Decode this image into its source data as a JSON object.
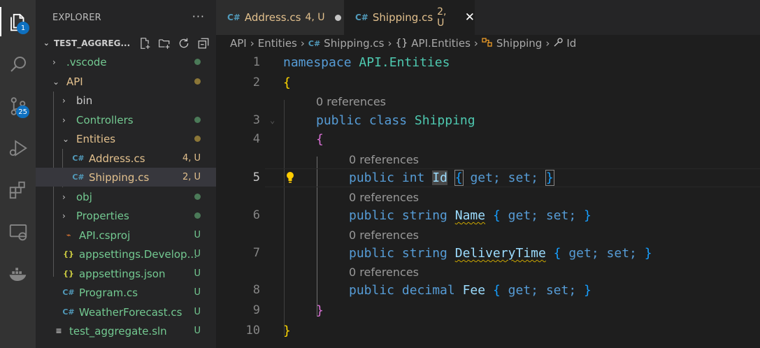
{
  "colors": {
    "accent": "#0e70c0",
    "modified": "#e2c08d",
    "untracked": "#73c991",
    "folder_dot_modified": "#8b7637",
    "folder_dot_green": "#4b7a58",
    "csharp_icon": "#519aba",
    "json_icon": "#cbcb41",
    "xml_icon": "#e37933",
    "sln_icon": "#c5c5c5"
  },
  "activity_bar": {
    "explorer_badge": "1",
    "scm_badge": "25",
    "icons": [
      "files-icon",
      "search-icon",
      "source-control-icon",
      "run-debug-icon",
      "extensions-icon",
      "remote-explorer-icon",
      "docker-icon"
    ]
  },
  "sidebar": {
    "title": "EXPLORER",
    "more_label": "···",
    "folder": "TEST_AGGREG...",
    "items": [
      {
        "label": ".vscode",
        "chevron": "›",
        "status": "",
        "dot": "green"
      },
      {
        "label": "API",
        "chevron": "⌄",
        "status": "",
        "dot": "modified"
      },
      {
        "label": "bin",
        "chevron": "›",
        "status": "",
        "dot": ""
      },
      {
        "label": "Controllers",
        "chevron": "›",
        "status": "",
        "dot": "green"
      },
      {
        "label": "Entities",
        "chevron": "⌄",
        "status": "",
        "dot": "modified"
      },
      {
        "label": "Address.cs",
        "icon": "C#",
        "status": "4, U",
        "dot": ""
      },
      {
        "label": "Shipping.cs",
        "icon": "C#",
        "status": "2, U",
        "dot": ""
      },
      {
        "label": "obj",
        "chevron": "›",
        "status": "",
        "dot": "green"
      },
      {
        "label": "Properties",
        "chevron": "›",
        "status": "",
        "dot": "green"
      },
      {
        "label": "API.csproj",
        "icon": "rss",
        "status": "U",
        "dot": ""
      },
      {
        "label": "appsettings.Develop...",
        "icon": "{}",
        "status": "U",
        "dot": ""
      },
      {
        "label": "appsettings.json",
        "icon": "{}",
        "status": "U",
        "dot": ""
      },
      {
        "label": "Program.cs",
        "icon": "C#",
        "status": "U",
        "dot": ""
      },
      {
        "label": "WeatherForecast.cs",
        "icon": "C#",
        "status": "U",
        "dot": ""
      },
      {
        "label": "test_aggregate.sln",
        "icon": "≡",
        "status": "U",
        "dot": ""
      }
    ]
  },
  "tabs": [
    {
      "icon": "C#",
      "name": "Address.cs",
      "status": "4, U",
      "active": false
    },
    {
      "icon": "C#",
      "name": "Shipping.cs",
      "status": "2, U",
      "active": true,
      "close": "✕"
    }
  ],
  "breadcrumb": {
    "parts": [
      "API",
      "Entities",
      "Shipping.cs",
      "API.Entities",
      "Shipping",
      "Id"
    ],
    "icons": [
      "",
      "",
      "C#",
      "{}",
      "class-icon",
      "wrench-icon"
    ],
    "separator": "›"
  },
  "editor": {
    "lens_text": "0 references",
    "line_numbers": [
      "1",
      "2",
      "3",
      "4",
      "5",
      "6",
      "7",
      "8",
      "9",
      "10"
    ],
    "lines": [
      [
        "namespace",
        "API.Entities"
      ],
      [
        "{"
      ],
      [
        "public",
        "class",
        "Shipping"
      ],
      [
        "{"
      ],
      [
        "public",
        "int",
        "Id",
        "{",
        "get;",
        "set;",
        "}"
      ],
      [
        "public",
        "string",
        "Name",
        "{",
        "get;",
        "set;",
        "}"
      ],
      [
        "public",
        "string",
        "DeliveryTime",
        "{",
        "get;",
        "set;",
        "}"
      ],
      [
        "public",
        "decimal",
        "Fee",
        "{",
        "get;",
        "set;",
        "}"
      ],
      [
        "}"
      ],
      [
        "}"
      ]
    ]
  }
}
